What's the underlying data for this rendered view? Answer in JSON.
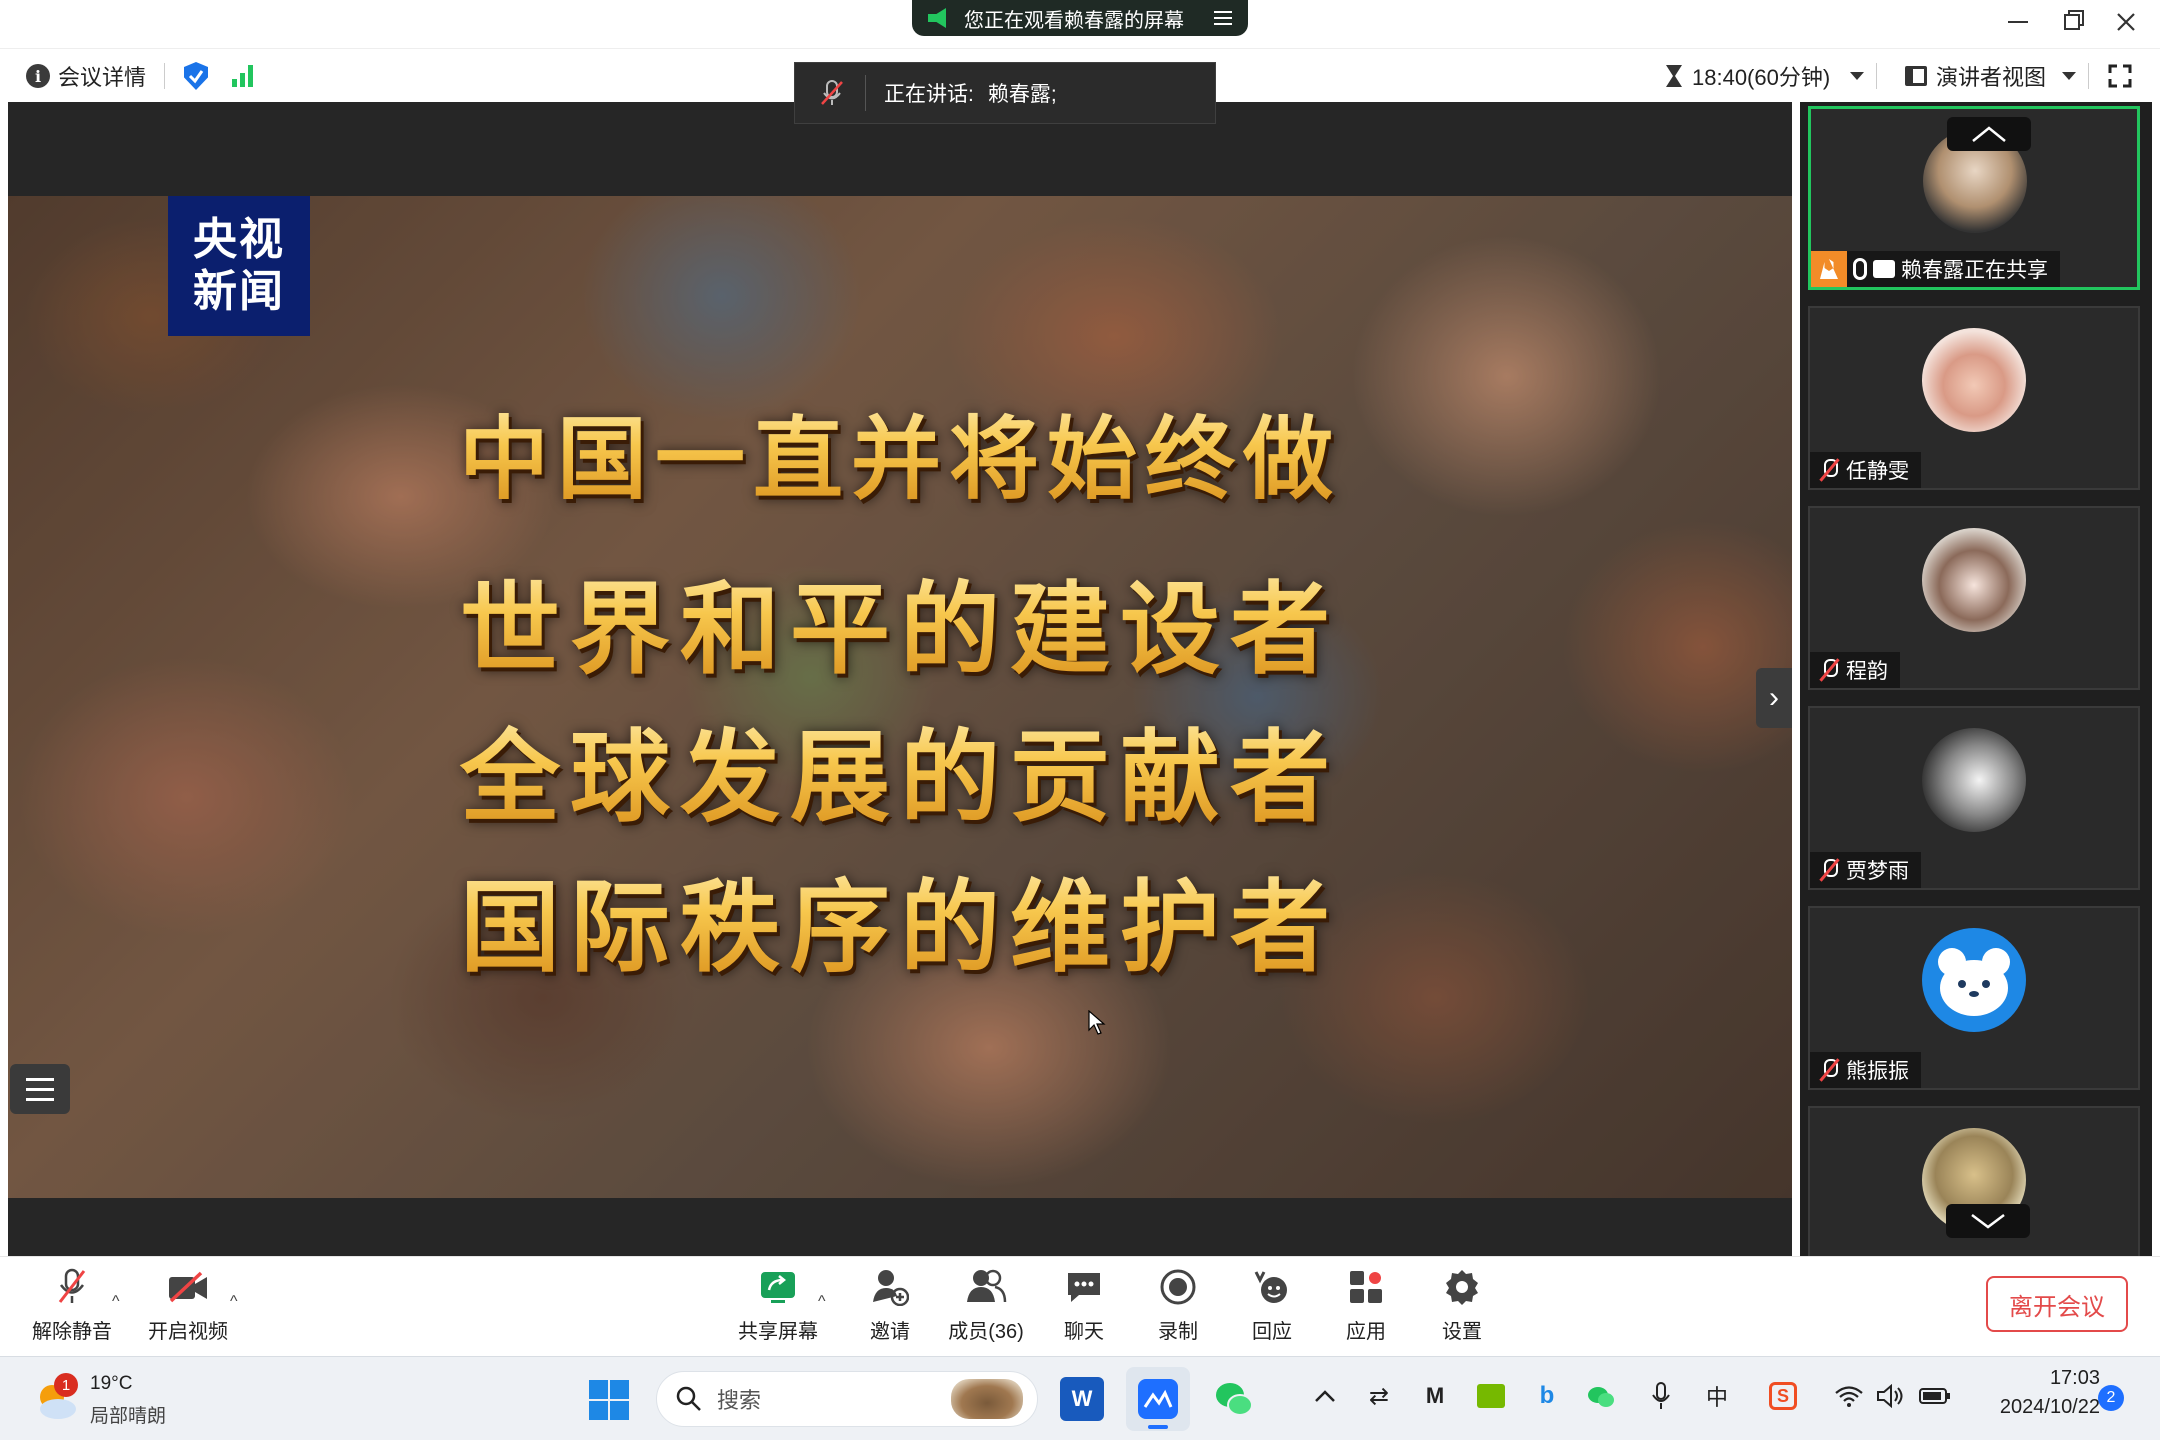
{
  "window": {
    "banner": "您正在观看赖春露的屏幕",
    "controls": [
      "minimize",
      "restore",
      "close"
    ]
  },
  "header": {
    "meeting_details": "会议详情",
    "timer": "18:40(60分钟)",
    "view_mode": "演讲者视图"
  },
  "speaking": {
    "prefix": "正在讲话:",
    "name": "赖春露;"
  },
  "shared_content": {
    "logo": "央视\n新闻",
    "line1": "中国一直并将始终做",
    "line2": "世界和平的建设者",
    "line3": "全球发展的贡献者",
    "line4": "国际秩序的维护者"
  },
  "participants": [
    {
      "name": "赖春露正在共享",
      "role": "host",
      "active": true
    },
    {
      "name": "任静雯",
      "muted": true
    },
    {
      "name": "程韵",
      "muted": true
    },
    {
      "name": "贾梦雨",
      "muted": true
    },
    {
      "name": "熊振振",
      "muted": true
    },
    {
      "name": "",
      "muted": true
    }
  ],
  "toolbar": {
    "unmute": "解除静音",
    "start_video": "开启视频",
    "share_screen": "共享屏幕",
    "invite": "邀请",
    "members": "成员(36)",
    "chat": "聊天",
    "record": "录制",
    "react": "回应",
    "apps": "应用",
    "settings": "设置",
    "leave": "离开会议"
  },
  "taskbar": {
    "weather_temp": "19°C",
    "weather_desc": "局部晴朗",
    "weather_badge": "1",
    "search_placeholder": "搜索",
    "ime": "中",
    "time": "17:03",
    "date": "2024/10/22",
    "notification_count": "2"
  },
  "colors": {
    "accent_green": "#22c55e",
    "leave_red": "#e34a4a",
    "host_orange": "#f28c28",
    "cctv_blue": "#0b1f6e"
  }
}
